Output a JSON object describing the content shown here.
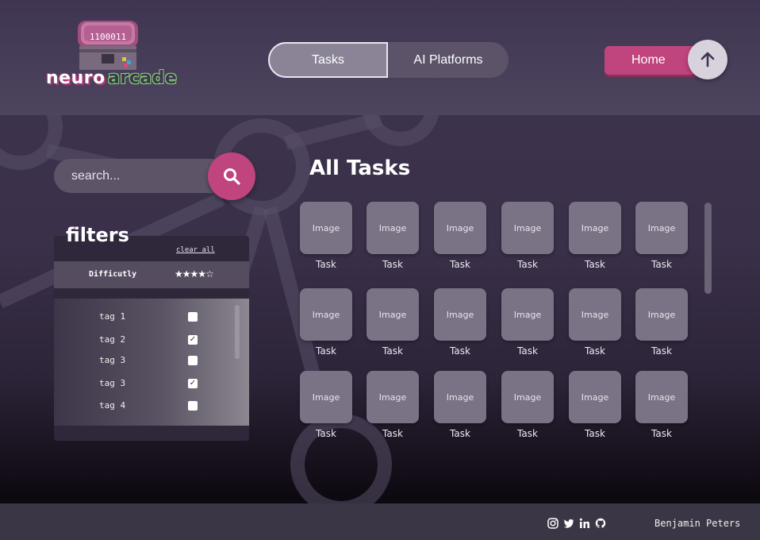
{
  "brand": {
    "word1": "neuro",
    "word2": "arcade",
    "chest_text": "1100011"
  },
  "nav": {
    "tabs": [
      {
        "label": "Tasks",
        "active": true
      },
      {
        "label": "AI Platforms",
        "active": false
      }
    ],
    "home_label": "Home",
    "up_icon": "arrow-up-icon"
  },
  "search": {
    "placeholder": "search...",
    "icon": "search-icon"
  },
  "filters": {
    "title": "filters",
    "clear_all": "clear all",
    "difficulty_label": "Difficutly",
    "difficulty_rating": 4,
    "difficulty_max": 5,
    "tags": [
      {
        "label": "tag 1",
        "checked": false
      },
      {
        "label": "tag 2",
        "checked": true
      },
      {
        "label": "tag 3",
        "checked": false
      },
      {
        "label": "tag 3",
        "checked": true
      },
      {
        "label": "tag 4",
        "checked": false
      }
    ]
  },
  "tasks": {
    "title": "All Tasks",
    "image_text": "Image",
    "task_label": "Task",
    "rows": 3,
    "cols": 6
  },
  "footer": {
    "icons": [
      "instagram-icon",
      "twitter-icon",
      "linkedin-icon",
      "github-icon"
    ],
    "author": "Benjamin Peters"
  },
  "colors": {
    "accent": "#c0447e",
    "panel": "#2f283a",
    "tile": "#7a7285"
  }
}
